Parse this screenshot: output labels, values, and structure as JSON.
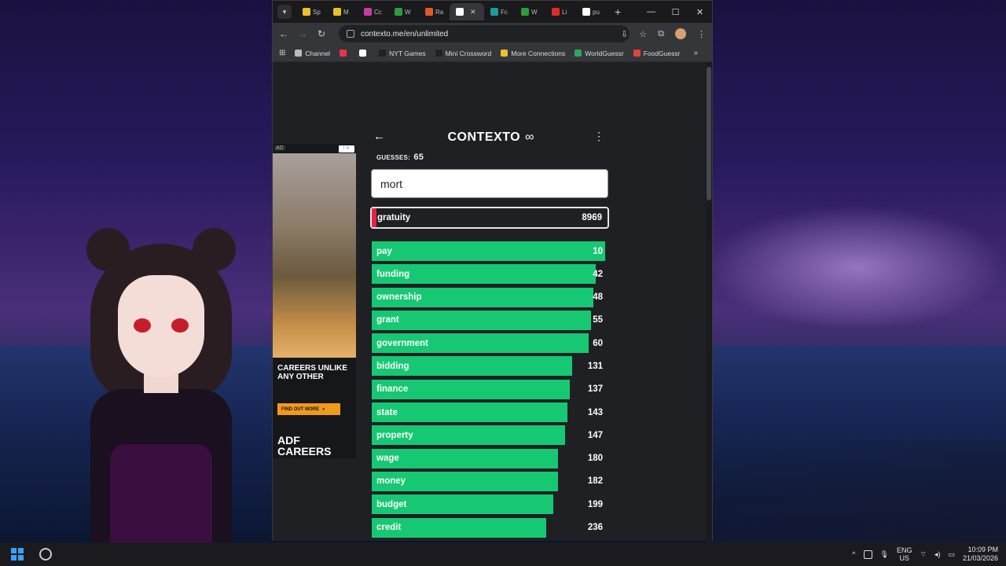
{
  "taskbar": {
    "lang_top": "ENG",
    "lang_bottom": "US",
    "time": "10:09 PM",
    "date": "21/03/2026"
  },
  "browser": {
    "tabs": [
      {
        "label": "Sp",
        "color": "#e9c22b"
      },
      {
        "label": "M",
        "color": "#e9c22b"
      },
      {
        "label": "Cc",
        "color": "#c83ca0"
      },
      {
        "label": "W",
        "color": "#2c9c3c"
      },
      {
        "label": "Ra",
        "color": "#e0572c"
      },
      {
        "label": "",
        "color": "#ffffff",
        "active": true
      },
      {
        "label": "Fc",
        "color": "#1a9c9c"
      },
      {
        "label": "W",
        "color": "#2c9c3c"
      },
      {
        "label": "Li",
        "color": "#e02a2a"
      },
      {
        "label": "pu",
        "color": "#ffffff"
      }
    ],
    "url": "contexto.me/en/unlimited",
    "bookmarks": [
      {
        "label": "Channel",
        "color": "#bbbbbb"
      },
      {
        "label": "",
        "color": "#e6354a"
      },
      {
        "label": "",
        "color": "#ffffff"
      },
      {
        "label": "NYT Games",
        "color": "#222222"
      },
      {
        "label": "Mini Crossword",
        "color": "#222222"
      },
      {
        "label": "More Connections",
        "color": "#e9c22b"
      },
      {
        "label": "WorldGuessr",
        "color": "#2aa85a"
      },
      {
        "label": "FoodGuessr",
        "color": "#e3433a"
      }
    ]
  },
  "ad": {
    "tag": "AD",
    "headline": "CAREERS UNLIKE ANY OTHER",
    "button": "FIND OUT MORE",
    "logo": "ADF CAREERS"
  },
  "game": {
    "title": "CONTEXTO",
    "guesses_label": "GUESSES:",
    "guesses_count": "65",
    "input_value": "mort",
    "last_guess": {
      "word": "gratuity",
      "rank": "8969",
      "fill": 0.02
    },
    "accent": "#16c872",
    "rows": [
      {
        "word": "pay",
        "rank": "10",
        "fill": 0.99
      },
      {
        "word": "funding",
        "rank": "42",
        "fill": 0.95
      },
      {
        "word": "ownership",
        "rank": "48",
        "fill": 0.94
      },
      {
        "word": "grant",
        "rank": "55",
        "fill": 0.93
      },
      {
        "word": "government",
        "rank": "60",
        "fill": 0.92
      },
      {
        "word": "bidding",
        "rank": "131",
        "fill": 0.85
      },
      {
        "word": "finance",
        "rank": "137",
        "fill": 0.84
      },
      {
        "word": "state",
        "rank": "143",
        "fill": 0.83
      },
      {
        "word": "property",
        "rank": "147",
        "fill": 0.82
      },
      {
        "word": "wage",
        "rank": "180",
        "fill": 0.79
      },
      {
        "word": "money",
        "rank": "182",
        "fill": 0.79
      },
      {
        "word": "budget",
        "rank": "199",
        "fill": 0.77
      },
      {
        "word": "credit",
        "rank": "236",
        "fill": 0.74
      }
    ]
  }
}
